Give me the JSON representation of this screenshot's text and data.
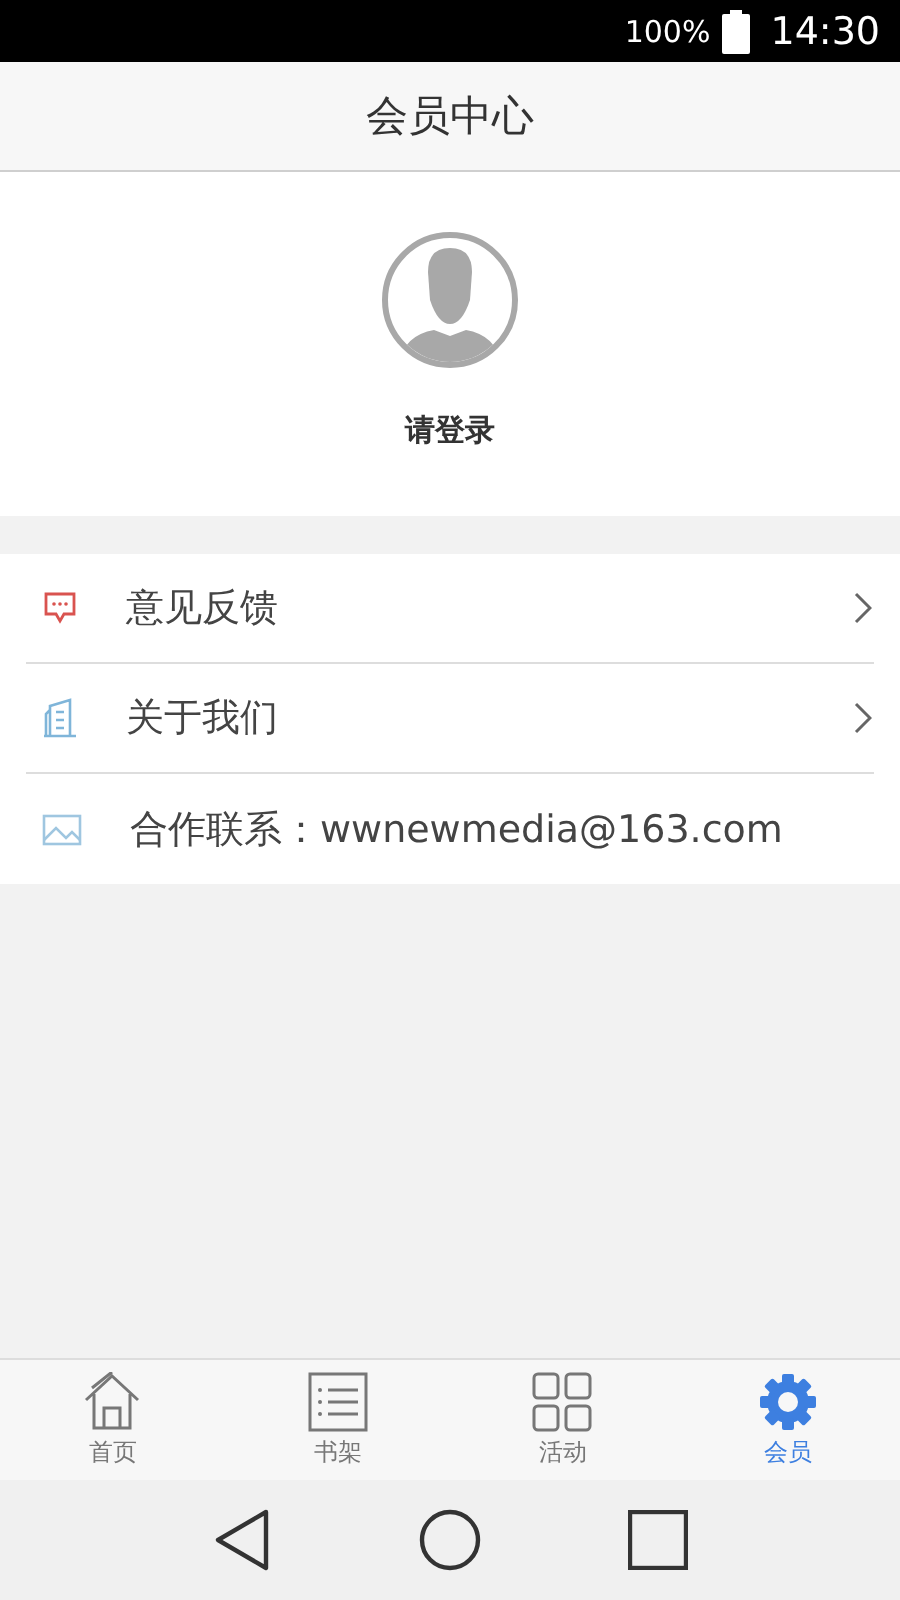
{
  "status_bar": {
    "battery": "100%",
    "time": "14:30"
  },
  "header": {
    "title": "会员中心"
  },
  "profile": {
    "login": "请登录"
  },
  "menu": [
    {
      "label": "意见反馈",
      "kind": "link"
    },
    {
      "label": "关于我们",
      "kind": "link"
    },
    {
      "label": "合作联系：wwnewmedia@163.com",
      "kind": "info"
    }
  ],
  "tabs": [
    {
      "label": "首页",
      "selected": false
    },
    {
      "label": "书架",
      "selected": false
    },
    {
      "label": "活动",
      "selected": false
    },
    {
      "label": "会员",
      "selected": true
    }
  ]
}
